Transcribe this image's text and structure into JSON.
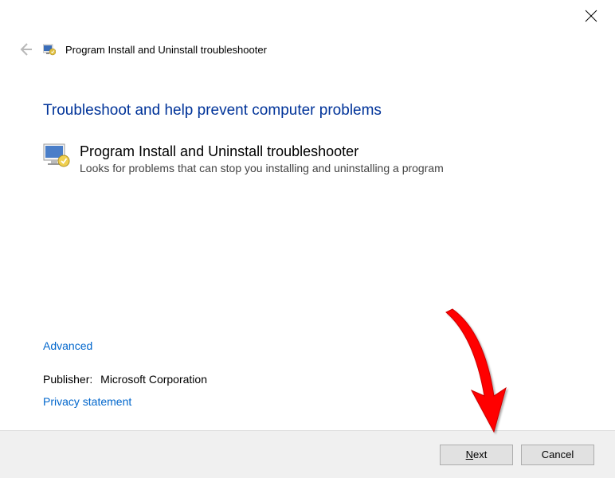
{
  "titlebar": {
    "close_label": "Close"
  },
  "header": {
    "app_title": "Program Install and Uninstall troubleshooter"
  },
  "main": {
    "headline": "Troubleshoot and help prevent computer problems",
    "section_title": "Program Install and Uninstall troubleshooter",
    "section_desc": "Looks for problems that can stop you installing and uninstalling a program"
  },
  "footer": {
    "advanced": "Advanced",
    "publisher_label": "Publisher:",
    "publisher_value": "Microsoft Corporation",
    "privacy": "Privacy statement"
  },
  "buttons": {
    "next_prefix": "N",
    "next_rest": "ext",
    "cancel": "Cancel"
  }
}
